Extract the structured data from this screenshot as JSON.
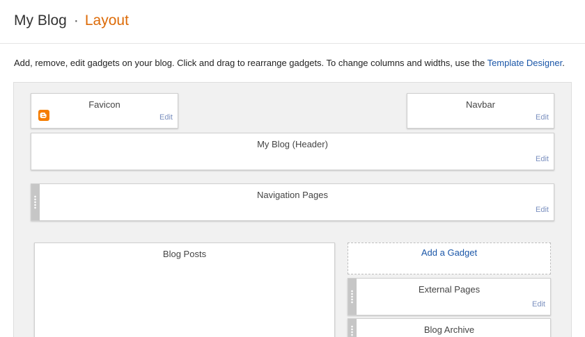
{
  "header": {
    "blog_name": "My Blog",
    "separator": "·",
    "page_name": "Layout"
  },
  "intro": {
    "text": "Add, remove, edit gadgets on your blog. Click and drag to rearrange gadgets. To change columns and widths, use the ",
    "link": "Template Designer",
    "end": "."
  },
  "gadgets": {
    "favicon": {
      "title": "Favicon",
      "edit": "Edit",
      "icon": "blogger-icon"
    },
    "navbar": {
      "title": "Navbar",
      "edit": "Edit"
    },
    "header": {
      "title": "My Blog (Header)",
      "edit": "Edit"
    },
    "navigation_pages": {
      "title": "Navigation Pages",
      "edit": "Edit"
    },
    "blog_posts": {
      "title": "Blog Posts"
    },
    "add_gadget": {
      "label": "Add a Gadget"
    },
    "external_pages": {
      "title": "External Pages",
      "edit": "Edit"
    },
    "blog_archive": {
      "title": "Blog Archive"
    }
  },
  "colors": {
    "accent": "#dd6b08",
    "link": "#1a56a8",
    "edit_link": "#7a8fbf",
    "canvas": "#f1f1f1",
    "blogger": "#f57d00"
  }
}
